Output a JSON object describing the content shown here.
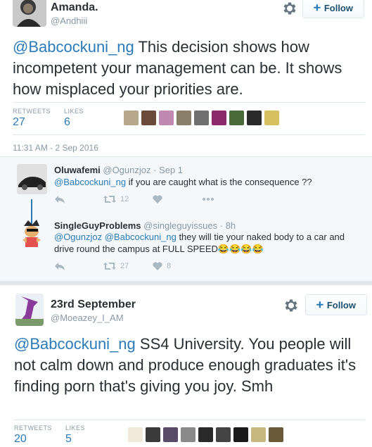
{
  "tweet1": {
    "name": "Amanda.",
    "handle": "@Andhiii",
    "follow_label": "Follow",
    "mention": "@Babcockuni_ng",
    "text": " This decision shows how incompetent your management can be. It shows how misplaced your priorities are.",
    "retweets_label": "RETWEETS",
    "retweets": "27",
    "likes_label": "LIKES",
    "likes": "6",
    "timestamp": "11:31 AM - 2 Sep 2016"
  },
  "reply1": {
    "name": "Oluwafemi",
    "handle": "@Ogunzjoz · Sep 1",
    "mention": "@Babcockuni_ng",
    "text": " if you are caught what is the consequence ??",
    "retweets": "12"
  },
  "reply2": {
    "name": "SingleGuyProblems",
    "handle": "@singleguyissues · 8h",
    "mention": "@Ogunzjoz @Babcockuni_ng",
    "text": " they will tie your naked body to a car and drive round the campus at FULL SPEED😂😂😂😂",
    "retweets": "27",
    "likes": "8"
  },
  "tweet2": {
    "name": "23rd September",
    "handle": "@Moeazey_I_AM",
    "follow_label": "Follow",
    "mention": "@Babcockuni_ng",
    "text": " SS4 University. You people will not calm down and produce enough graduates it's finding porn that's giving you joy. Smh",
    "retweets_label": "RETWEETS",
    "retweets": "20",
    "likes_label": "LIKES",
    "likes": "5"
  },
  "colors": {
    "link": "#2b7bb9",
    "muted": "#8899a6",
    "text": "#292f33"
  },
  "icons": [
    "gear-icon",
    "follow-user-icon",
    "reply-icon",
    "retweet-icon",
    "like-icon",
    "more-icon"
  ]
}
